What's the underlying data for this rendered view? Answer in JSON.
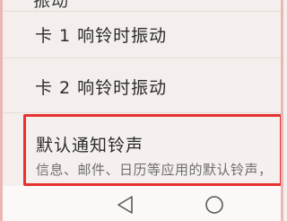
{
  "settings": {
    "partial_top_item": "振动",
    "items": [
      {
        "label": "卡 1 响铃时振动"
      },
      {
        "label": "卡 2 响铃时振动"
      }
    ],
    "highlighted": {
      "title": "默认通知铃声",
      "description": "信息、邮件、日历等应用的默认铃声，也可进行个性化设置"
    }
  },
  "navbar": {
    "back_icon": "back-triangle-icon",
    "home_icon": "home-circle-icon"
  },
  "colors": {
    "highlight_border": "#e8322f",
    "background": "#f4efec"
  }
}
